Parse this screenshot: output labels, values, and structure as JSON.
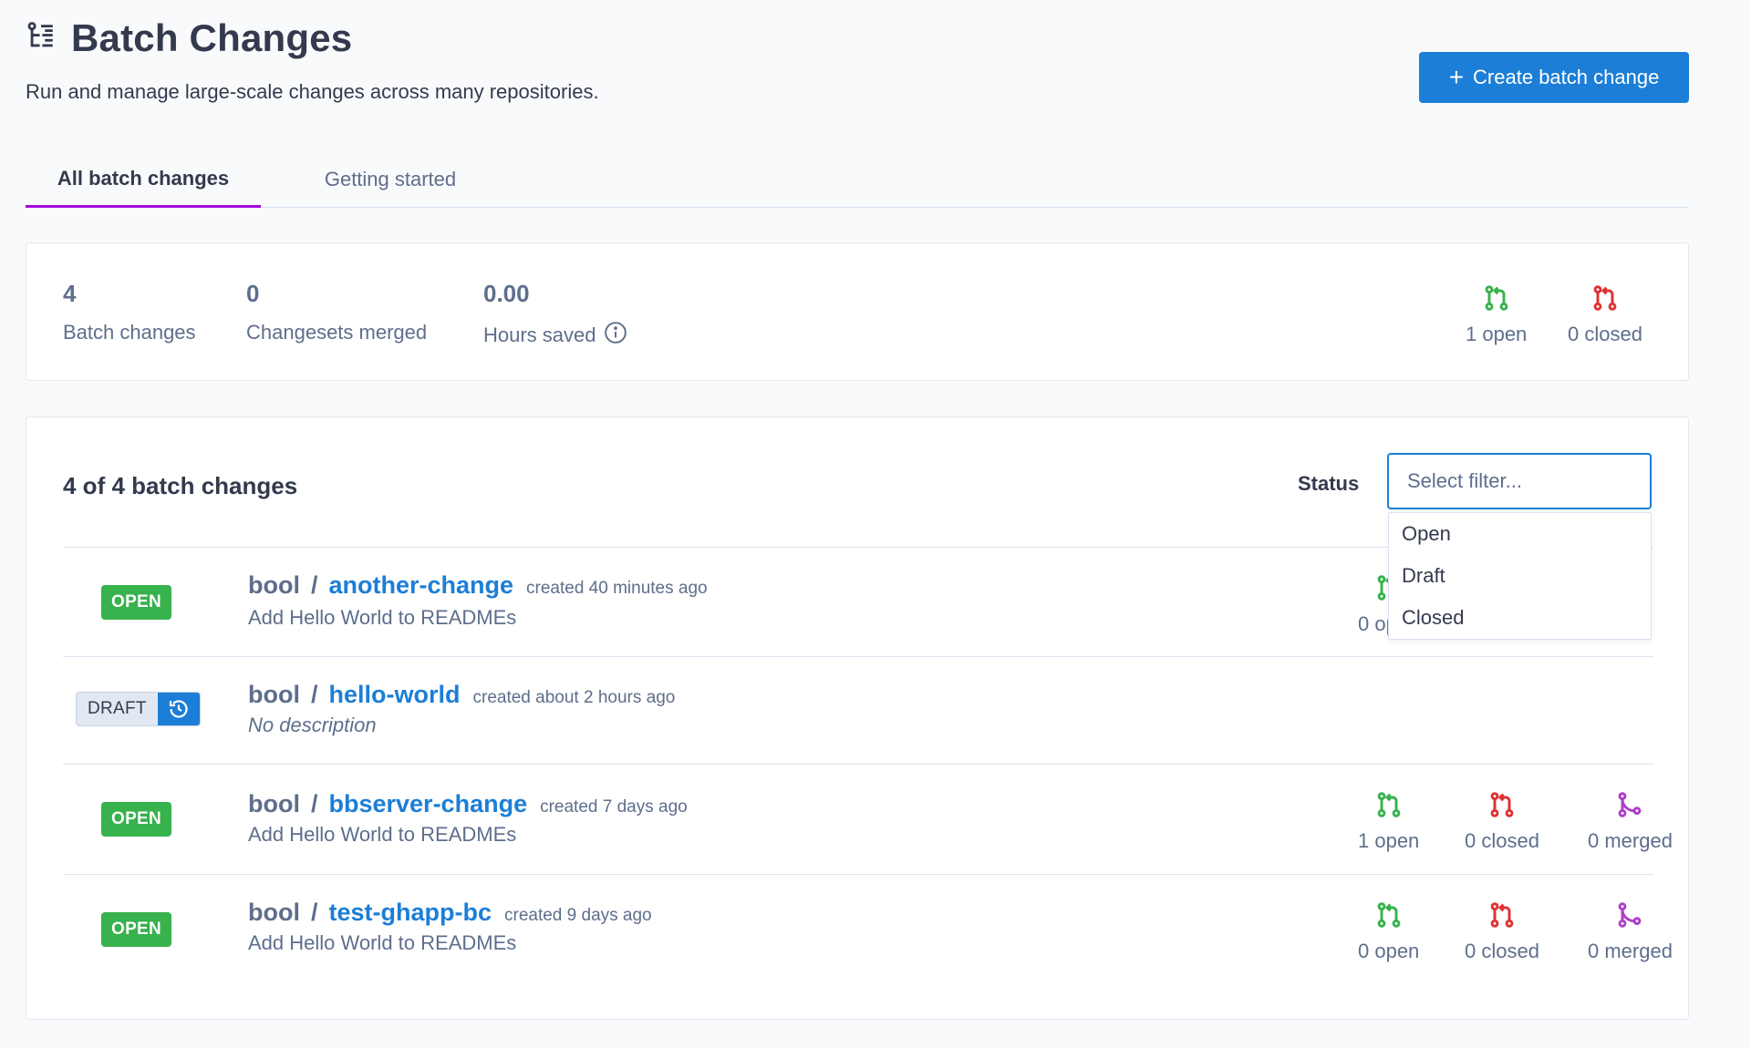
{
  "header": {
    "title": "Batch Changes",
    "subtitle": "Run and manage large-scale changes across many repositories.",
    "create_button_label": "Create batch change"
  },
  "tabs": [
    {
      "label": "All batch changes",
      "active": true
    },
    {
      "label": "Getting started",
      "active": false
    }
  ],
  "stats": {
    "batch_changes": {
      "value": "4",
      "label": "Batch changes"
    },
    "changesets_merged": {
      "value": "0",
      "label": "Changesets merged"
    },
    "hours_saved": {
      "value": "0.00",
      "label": "Hours saved"
    },
    "open_label": "1 open",
    "closed_label": "0 closed"
  },
  "list": {
    "count_label": "4 of 4 batch changes",
    "status_label": "Status",
    "filter_placeholder": "Select filter...",
    "filter_options": [
      "Open",
      "Draft",
      "Closed"
    ],
    "rows": [
      {
        "state": "OPEN",
        "namespace": "bool",
        "separator": "/",
        "name": "another-change",
        "created": "created 40 minutes ago",
        "description": "Add Hello World to READMEs",
        "open": "0 open",
        "closed": "",
        "merged": ""
      },
      {
        "state": "DRAFT",
        "namespace": "bool",
        "separator": "/",
        "name": "hello-world",
        "created": "created about 2 hours ago",
        "description": "No description"
      },
      {
        "state": "OPEN",
        "namespace": "bool",
        "separator": "/",
        "name": "bbserver-change",
        "created": "created 7 days ago",
        "description": "Add Hello World to READMEs",
        "open": "1 open",
        "closed": "0 closed",
        "merged": "0 merged"
      },
      {
        "state": "OPEN",
        "namespace": "bool",
        "separator": "/",
        "name": "test-ghapp-bc",
        "created": "created 9 days ago",
        "description": "Add Hello World to READMEs",
        "open": "0 open",
        "closed": "0 closed",
        "merged": "0 merged"
      }
    ]
  },
  "colors": {
    "accent": "#1c7ed6",
    "open_green": "#37b24d",
    "closed_red": "#e03131",
    "merged_purple": "#ae3ec9",
    "tab_underline": "#a305e1"
  }
}
